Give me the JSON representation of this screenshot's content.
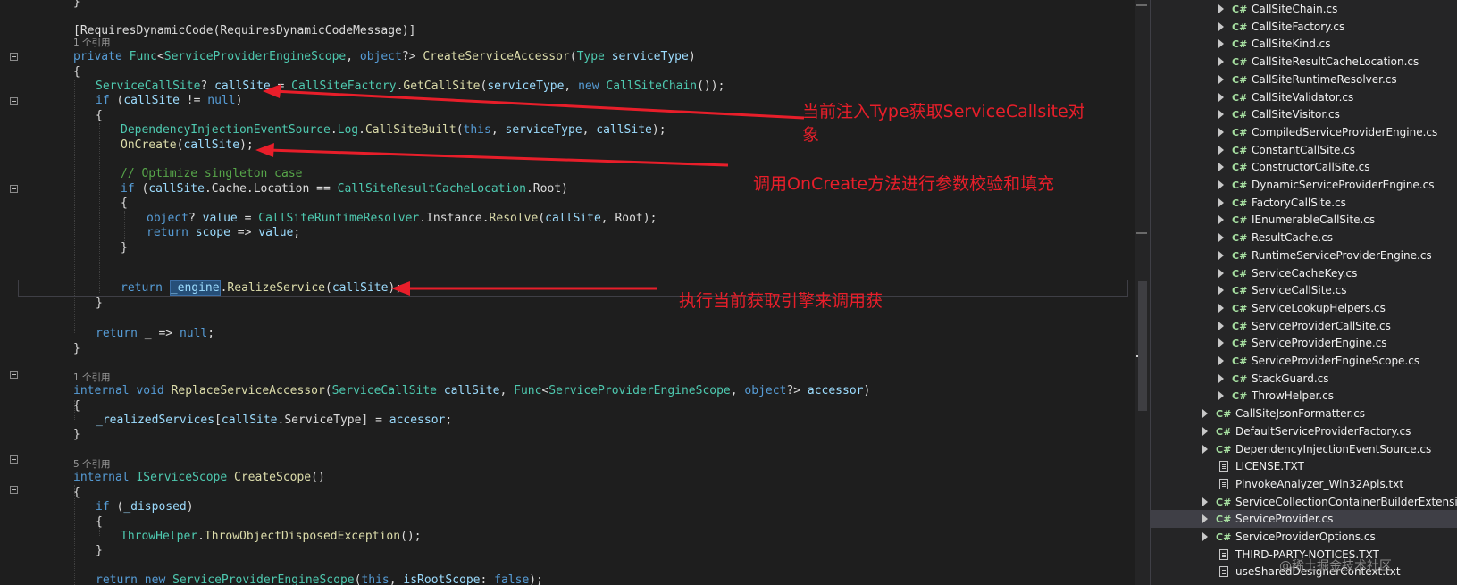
{
  "code": {
    "lines": {
      "l01": "}",
      "l02": "[RequiresDynamicCode(RequiresDynamicCodeMessage)]",
      "l03": "private Func<ServiceProviderEngineScope, object?> CreateServiceAccessor(Type serviceType)",
      "l04": "{",
      "l05": "ServiceCallSite? callSite = CallSiteFactory.GetCallSite(serviceType, new CallSiteChain());",
      "l06": "if (callSite != null)",
      "l07": "{",
      "l08": "DependencyInjectionEventSource.Log.CallSiteBuilt(this, serviceType, callSite);",
      "l09": "OnCreate(callSite);",
      "l10": "// Optimize singleton case",
      "l11": "if (callSite.Cache.Location == CallSiteResultCacheLocation.Root)",
      "l12": "{",
      "l13": "object? value = CallSiteRuntimeResolver.Instance.Resolve(callSite, Root);",
      "l14": "return scope => value;",
      "l15": "}",
      "l16": "return _engine.RealizeService(callSite);",
      "l17": "}",
      "l18": "return _ => null;",
      "l19": "}",
      "l20": "internal void ReplaceServiceAccessor(ServiceCallSite callSite, Func<ServiceProviderEngineScope, object?> accessor)",
      "l21": "{",
      "l22": "_realizedServices[callSite.ServiceType] = accessor;",
      "l23": "}",
      "l24": "internal IServiceScope CreateScope()",
      "l25": "{",
      "l26": "if (_disposed)",
      "l27": "{",
      "l28": "ThrowHelper.ThrowObjectDisposedException();",
      "l29": "}",
      "l30": "return new ServiceProviderEngineScope(this, isRootScope: false);"
    },
    "codelens": {
      "c1": "1 个引用",
      "c2": "1 个引用",
      "c3": "5 个引用"
    }
  },
  "annotations": {
    "a1_line1": "当前注入Type获取ServiceCallsite对",
    "a1_line2": "象",
    "a2": "调用OnCreate方法进行参数校验和填充",
    "a3": "执行当前获取引擎来调用获"
  },
  "annotation_color": "#e81e2a",
  "solution_explorer": {
    "items": [
      {
        "label": "CallSiteChain.cs",
        "icon": "csharp-file-icon"
      },
      {
        "label": "CallSiteFactory.cs",
        "icon": "csharp-file-icon"
      },
      {
        "label": "CallSiteKind.cs",
        "icon": "csharp-file-icon"
      },
      {
        "label": "CallSiteResultCacheLocation.cs",
        "icon": "csharp-file-icon"
      },
      {
        "label": "CallSiteRuntimeResolver.cs",
        "icon": "csharp-file-icon"
      },
      {
        "label": "CallSiteValidator.cs",
        "icon": "csharp-file-icon"
      },
      {
        "label": "CallSiteVisitor.cs",
        "icon": "csharp-file-icon"
      },
      {
        "label": "CompiledServiceProviderEngine.cs",
        "icon": "csharp-file-icon"
      },
      {
        "label": "ConstantCallSite.cs",
        "icon": "csharp-file-icon"
      },
      {
        "label": "ConstructorCallSite.cs",
        "icon": "csharp-file-icon"
      },
      {
        "label": "DynamicServiceProviderEngine.cs",
        "icon": "csharp-file-icon"
      },
      {
        "label": "FactoryCallSite.cs",
        "icon": "csharp-file-icon"
      },
      {
        "label": "IEnumerableCallSite.cs",
        "icon": "csharp-file-icon"
      },
      {
        "label": "ResultCache.cs",
        "icon": "csharp-file-icon"
      },
      {
        "label": "RuntimeServiceProviderEngine.cs",
        "icon": "csharp-file-icon"
      },
      {
        "label": "ServiceCacheKey.cs",
        "icon": "csharp-file-icon"
      },
      {
        "label": "ServiceCallSite.cs",
        "icon": "csharp-file-icon"
      },
      {
        "label": "ServiceLookupHelpers.cs",
        "icon": "csharp-file-icon"
      },
      {
        "label": "ServiceProviderCallSite.cs",
        "icon": "csharp-file-icon"
      },
      {
        "label": "ServiceProviderEngine.cs",
        "icon": "csharp-file-icon"
      },
      {
        "label": "ServiceProviderEngineScope.cs",
        "icon": "csharp-file-icon"
      },
      {
        "label": "StackGuard.cs",
        "icon": "csharp-file-icon"
      },
      {
        "label": "ThrowHelper.cs",
        "icon": "csharp-file-icon"
      },
      {
        "label": "CallSiteJsonFormatter.cs",
        "icon": "csharp-file-icon"
      },
      {
        "label": "DefaultServiceProviderFactory.cs",
        "icon": "csharp-file-icon"
      },
      {
        "label": "DependencyInjectionEventSource.cs",
        "icon": "csharp-file-icon"
      },
      {
        "label": "LICENSE.TXT",
        "icon": "text-file-icon"
      },
      {
        "label": "PinvokeAnalyzer_Win32Apis.txt",
        "icon": "text-file-icon"
      },
      {
        "label": "ServiceCollectionContainerBuilderExtensions.cs",
        "icon": "csharp-file-icon"
      },
      {
        "label": "ServiceProvider.cs",
        "icon": "csharp-file-icon",
        "selected": true
      },
      {
        "label": "ServiceProviderOptions.cs",
        "icon": "csharp-file-icon"
      },
      {
        "label": "THIRD-PARTY-NOTICES.TXT",
        "icon": "text-file-icon"
      },
      {
        "label": "useSharedDesignerContext.txt",
        "icon": "text-file-icon"
      }
    ],
    "cs_glyph": "C#"
  },
  "watermark": "@稀土掘金技术社区"
}
